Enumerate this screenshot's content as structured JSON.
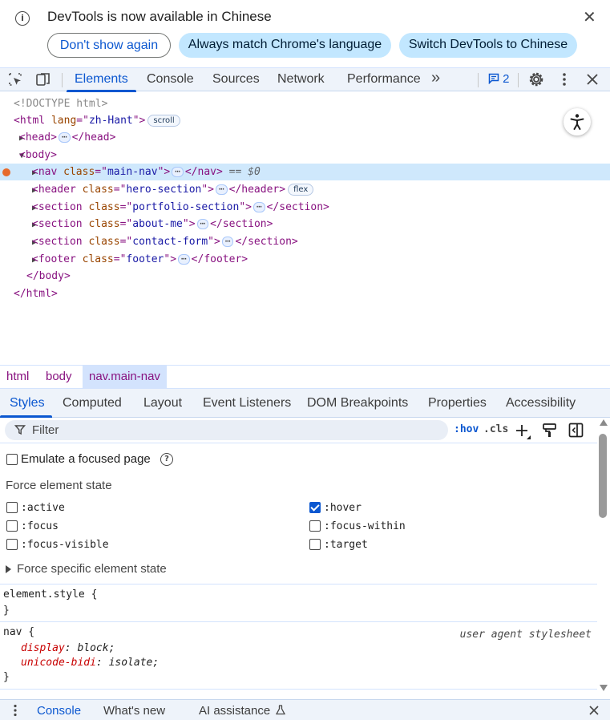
{
  "infobar": {
    "message": "DevTools is now available in Chinese",
    "dont_show": "Don't show again",
    "always_match": "Always match Chrome's language",
    "switch": "Switch DevTools to Chinese",
    "close_icon": "close-icon"
  },
  "toolbar": {
    "tabs": [
      "Elements",
      "Console",
      "Sources",
      "Network",
      "Performance"
    ],
    "more": "»",
    "issues_count": "2",
    "accent": "#0b57d0"
  },
  "dom": {
    "doctype": "<!DOCTYPE html>",
    "html_tag": "html",
    "html_attr": "lang",
    "html_val": "zh-Hant",
    "scroll_badge": "scroll",
    "head_tag": "head",
    "body_tag": "body",
    "nav": {
      "tag": "nav",
      "attr": "class",
      "val": "main-nav",
      "suffix": "== $0"
    },
    "children": [
      {
        "tag": "header",
        "attr": "class",
        "val": "hero-section",
        "badge": "flex"
      },
      {
        "tag": "section",
        "attr": "class",
        "val": "portfolio-section"
      },
      {
        "tag": "section",
        "attr": "class",
        "val": "about-me"
      },
      {
        "tag": "section",
        "attr": "class",
        "val": "contact-form"
      },
      {
        "tag": "footer",
        "attr": "class",
        "val": "footer"
      }
    ],
    "ellipsis": "⋯"
  },
  "breadcrumb": [
    "html",
    "body",
    "nav.main-nav"
  ],
  "subtabs": [
    "Styles",
    "Computed",
    "Layout",
    "Event Listeners",
    "DOM Breakpoints",
    "Properties",
    "Accessibility"
  ],
  "filter": {
    "placeholder": "Filter",
    "hov": ":hov",
    "cls": ".cls"
  },
  "state": {
    "emulate_focus": "Emulate a focused page",
    "force_title": "Force element state",
    "states": [
      {
        "label": ":active",
        "checked": false
      },
      {
        "label": ":hover",
        "checked": true
      },
      {
        "label": ":focus",
        "checked": false
      },
      {
        "label": ":focus-within",
        "checked": false
      },
      {
        "label": ":focus-visible",
        "checked": false
      },
      {
        "label": ":target",
        "checked": false
      }
    ],
    "force_specific": "Force specific element state"
  },
  "rules": {
    "element_style": "element.style {",
    "close_brace": "}",
    "nav_selector": "nav {",
    "nav_origin": "user agent stylesheet",
    "nav_props": [
      {
        "name": "display",
        "value": "block"
      },
      {
        "name": "unicode-bidi",
        "value": "isolate"
      }
    ]
  },
  "drawer": {
    "tabs": [
      "Console",
      "What's new",
      "AI assistance"
    ]
  }
}
